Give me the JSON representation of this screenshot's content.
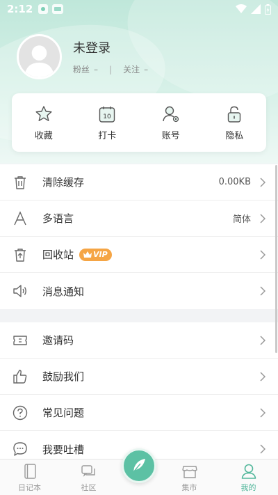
{
  "status_bar": {
    "time": "2:12"
  },
  "profile": {
    "name": "未登录",
    "fans_label": "粉丝",
    "fans_count": "–",
    "follow_label": "关注",
    "follow_count": "–"
  },
  "quick_actions": [
    {
      "label": "收藏",
      "icon": "star-icon"
    },
    {
      "label": "打卡",
      "icon": "calendar-icon",
      "badge": "10"
    },
    {
      "label": "账号",
      "icon": "user-gear-icon"
    },
    {
      "label": "隐私",
      "icon": "lock-icon"
    }
  ],
  "settings": {
    "clear_cache": {
      "label": "清除缓存",
      "value": "0.00KB"
    },
    "language": {
      "label": "多语言",
      "value": "简体"
    },
    "recycle_bin": {
      "label": "回收站",
      "badge": "VIP"
    },
    "notifications": {
      "label": "消息通知"
    }
  },
  "more": {
    "invite_code": {
      "label": "邀请码"
    },
    "encourage": {
      "label": "鼓励我们"
    },
    "faq": {
      "label": "常见问题"
    },
    "feedback": {
      "label": "我要吐槽"
    }
  },
  "bottom_nav": {
    "diary": "日记本",
    "community": "社区",
    "market": "集市",
    "mine": "我的"
  },
  "colors": {
    "accent": "#52b79b",
    "vip": "#f5a545",
    "header": "#bfe7da"
  }
}
